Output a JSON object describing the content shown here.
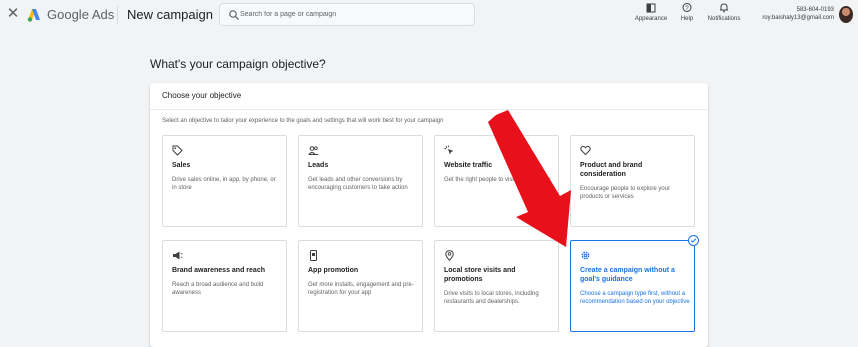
{
  "header": {
    "brand": "Google Ads",
    "page_title": "New campaign",
    "search_placeholder": "Search for a page or campaign",
    "tools": [
      {
        "label": "Appearance",
        "icon": "appearance-icon"
      },
      {
        "label": "Help",
        "icon": "help-icon"
      },
      {
        "label": "Notifications",
        "icon": "bell-icon"
      }
    ],
    "account_id": "583-604-0193",
    "account_email": "roy.baishaly13@gmail.com"
  },
  "main": {
    "heading": "What's your campaign objective?",
    "panel_title": "Choose your objective",
    "panel_description": "Select an objective to tailor your experience to the goals and settings that will work best for your campaign",
    "objectives": [
      {
        "title": "Sales",
        "description": "Drive sales online, in app, by phone, or in store",
        "icon": "tag-icon",
        "selected": false
      },
      {
        "title": "Leads",
        "description": "Get leads and other conversions by encouraging customers to take action",
        "icon": "people-icon",
        "selected": false
      },
      {
        "title": "Website traffic",
        "description": "Get the right people to visit your website",
        "icon": "cursor-click-icon",
        "selected": false
      },
      {
        "title": "Product and brand consideration",
        "description": "Encourage people to explore your products or services",
        "icon": "heart-icon",
        "selected": false
      },
      {
        "title": "Brand awareness and reach",
        "description": "Reach a broad audience and build awareness",
        "icon": "megaphone-icon",
        "selected": false
      },
      {
        "title": "App promotion",
        "description": "Get more installs, engagement and pre-registration for your app",
        "icon": "phone-icon",
        "selected": false
      },
      {
        "title": "Local store visits and promotions",
        "description": "Drive visits to local stores, including restaurants and dealerships.",
        "icon": "location-pin-icon",
        "selected": false
      },
      {
        "title": "Create a campaign without a goal's guidance",
        "description": "Choose a campaign type first, without a recommendation based on your objective",
        "icon": "gear-icon",
        "selected": true
      }
    ]
  },
  "colors": {
    "accent": "#1a73e8",
    "annotation_arrow": "#e8101a",
    "background": "#f1f3f4"
  }
}
